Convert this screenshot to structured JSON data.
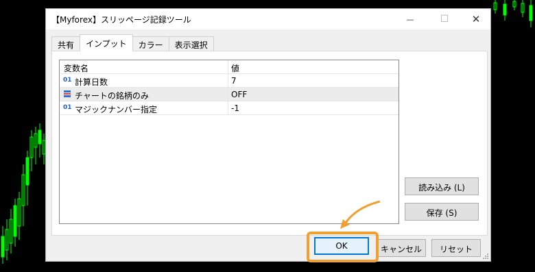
{
  "colors": {
    "background": "#000000",
    "candle_up": "#00ff00",
    "highlight": "#f0a030",
    "ok_border": "#0078d7",
    "icon_blue": "#1f5fbf"
  },
  "dialog": {
    "title": "【Myforex】スリッページ記録ツール",
    "minimize_icon": "minimize-icon",
    "maximize_icon": "maximize-icon",
    "close_icon": "close-icon",
    "close_glyph": "✕",
    "minimize_glyph": "—",
    "maximize_glyph": "☐"
  },
  "tabs": [
    {
      "label": "共有"
    },
    {
      "label": "インプット",
      "active": true
    },
    {
      "label": "カラー"
    },
    {
      "label": "表示選択"
    }
  ],
  "grid": {
    "columns": {
      "name": "変数名",
      "value": "値"
    },
    "rows": [
      {
        "icon": "o1-icon",
        "glyph": "01",
        "name": "計算日数",
        "value": "7"
      },
      {
        "icon": "list-icon",
        "glyph": "",
        "name": "チャートの銘柄のみ",
        "value": "OFF",
        "selected": true
      },
      {
        "icon": "o1-icon",
        "glyph": "01",
        "name": "マジックナンバー指定",
        "value": "-1"
      }
    ]
  },
  "side_buttons": {
    "load": "読み込み (L)",
    "save": "保存 (S)"
  },
  "bottom_buttons": {
    "ok": "OK",
    "cancel": "キャンセル",
    "reset": "リセット"
  }
}
